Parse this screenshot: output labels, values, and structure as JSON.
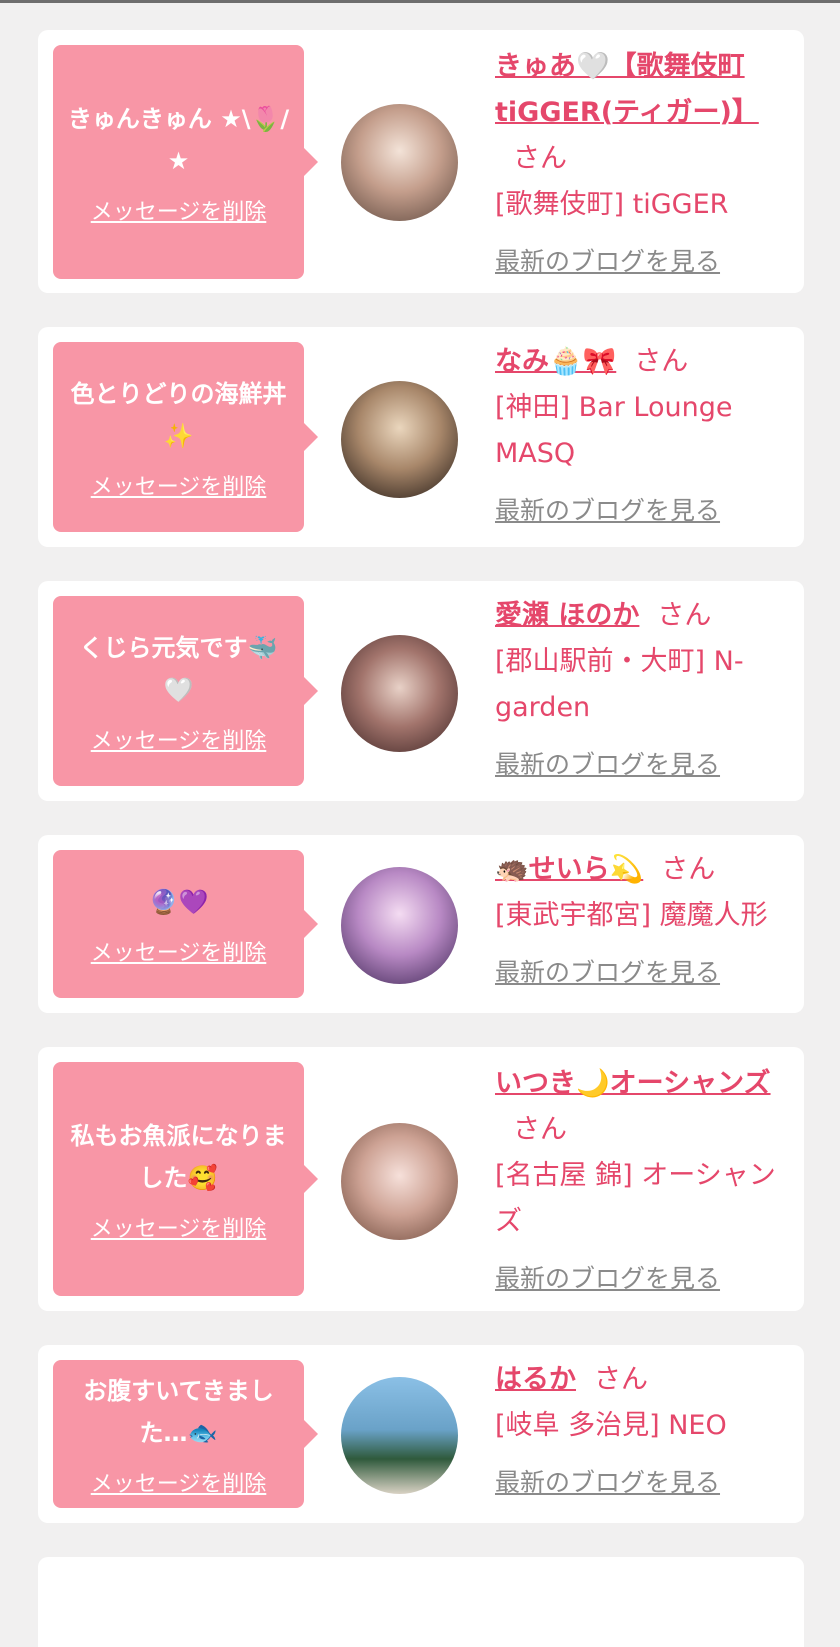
{
  "cards": [
    {
      "message": "きゅんきゅん ★\\🌷/★",
      "delete_label": "メッセージを削除",
      "name": "きゅあ🤍【歌舞伎町tiGGER(ティガー)】",
      "suffix": "さん",
      "store": "[歌舞伎町] tiGGER",
      "blog_label": "最新のブログを見る",
      "avatar_colors": [
        "#e8d6c8",
        "#8a6a5a"
      ]
    },
    {
      "message": "色とりどりの海鮮丼✨",
      "delete_label": "メッセージを削除",
      "name": "なみ🧁🎀",
      "suffix": "さん",
      "store": "[神田] Bar Lounge MASQ",
      "blog_label": "最新のブログを見る",
      "avatar_colors": [
        "#d8c2a6",
        "#3a2a22"
      ]
    },
    {
      "message": "くじら元気です🐳🤍",
      "delete_label": "メッセージを削除",
      "name": "愛瀬 ほのか",
      "suffix": "さん",
      "store": "[郡山駅前・大町] N-garden",
      "blog_label": "最新のブログを見る",
      "avatar_colors": [
        "#c9a9a0",
        "#5b3a38"
      ]
    },
    {
      "message": "🔮💜",
      "delete_label": "メッセージを削除",
      "name": "🦔せいら💫",
      "suffix": "さん",
      "store": "[東武宇都宮] 魔魔人形",
      "blog_label": "最新のブログを見る",
      "avatar_colors": [
        "#e7c7e8",
        "#5a3a70"
      ]
    },
    {
      "message": "私もお魚派になりました🥰",
      "delete_label": "メッセージを削除",
      "name": "いつき🌙オーシャンズ",
      "suffix": "さん",
      "store": "[名古屋 錦] オーシャンズ",
      "blog_label": "最新のブログを見る",
      "avatar_colors": [
        "#f0d6cc",
        "#8a5a4a"
      ]
    },
    {
      "message": "お腹すいてきました…🐟",
      "delete_label": "メッセージを削除",
      "name": "はるか",
      "suffix": "さん",
      "store": "[岐阜 多治見] NEO",
      "blog_label": "最新のブログを見る",
      "avatar_colors": [
        "#7fb0d8",
        "#2f4a36"
      ]
    }
  ]
}
